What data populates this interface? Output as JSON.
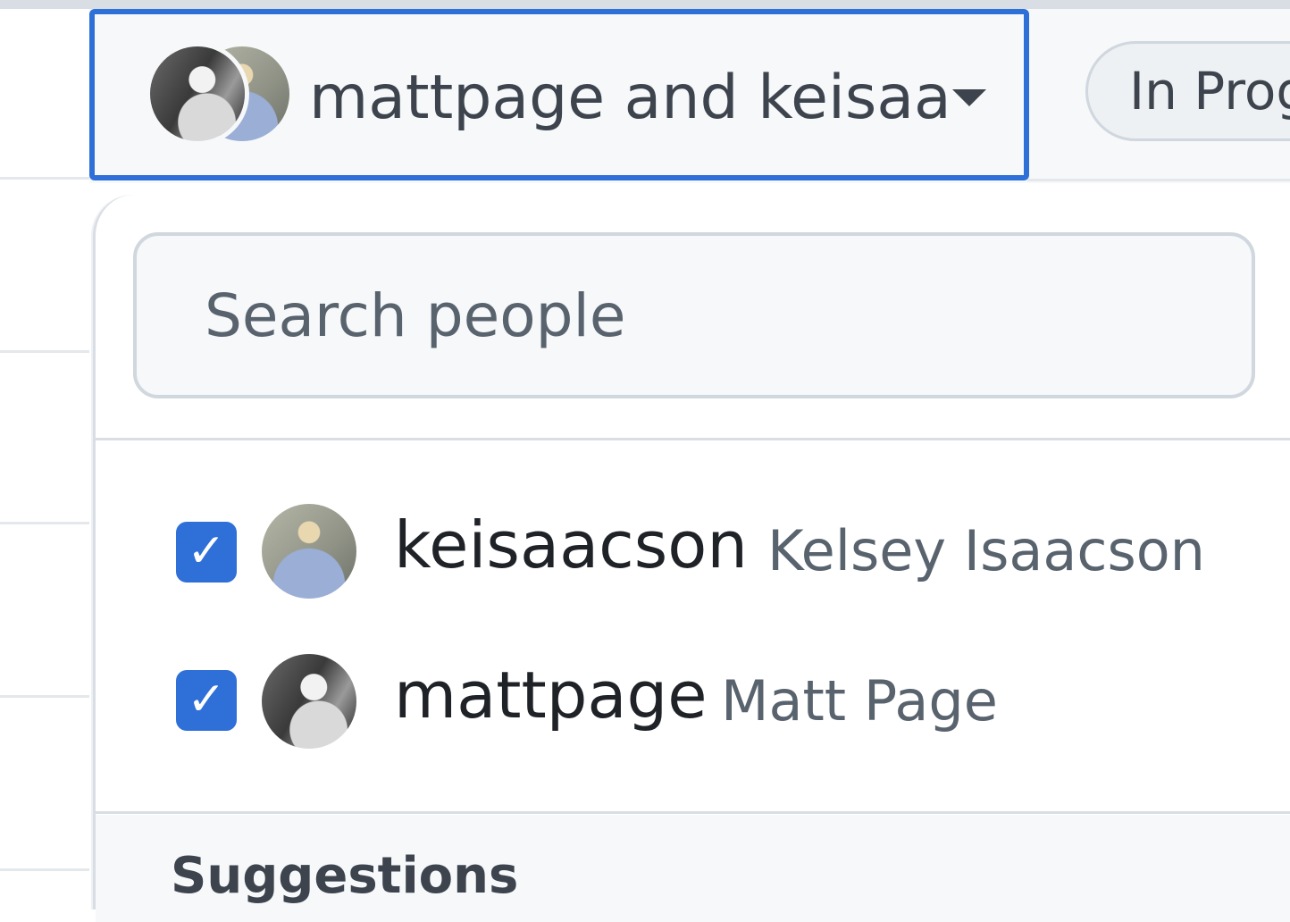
{
  "header": {
    "assignee_trigger_label": "mattpage and keisaa",
    "status_pill_label": "In Prog"
  },
  "dropdown": {
    "search": {
      "placeholder": "Search people",
      "value": ""
    },
    "selected_users": [
      {
        "username": "keisaacson",
        "full_name": "Kelsey Isaacson",
        "checked": true
      },
      {
        "username": "mattpage",
        "full_name": "Matt Page",
        "checked": true
      }
    ],
    "checkbox_glyph": "✓",
    "suggestions_heading": "Suggestions"
  },
  "colors": {
    "accent": "#2f6fd8",
    "text_primary": "#1f2328",
    "text_secondary": "#59636e",
    "border": "#d0d7de",
    "canvas_subtle": "#f6f8fa"
  },
  "icons": {
    "caret": "triangle-down-icon",
    "checkbox": "checkmark-icon"
  }
}
